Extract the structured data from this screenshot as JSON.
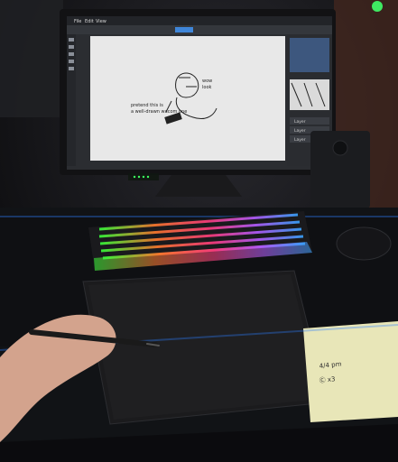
{
  "scene": {
    "type": "photo",
    "colors": {
      "background": "#0d0d0f",
      "monitor_bezel": "#121214",
      "canvas": "#e8e8e8",
      "app_dark": "#2b2d31",
      "tablet": "#1b1b1d",
      "desk_mat": "#111316",
      "note": "#e8e6b8",
      "keyboard_base": "#1a1a1d"
    }
  },
  "app": {
    "menu_items": [
      "File",
      "Edit",
      "View"
    ],
    "tab_label": "",
    "layer_labels": [
      "Layer",
      "Layer",
      "Layer"
    ]
  },
  "artwork": {
    "caption_line1": "pretend this is",
    "caption_line2": "a well-drawn wacom one",
    "speech_line1": "wow",
    "speech_line2": "look"
  },
  "sticky_note": {
    "line1": "4/4 pm",
    "line2": "Ⓒ x3"
  }
}
